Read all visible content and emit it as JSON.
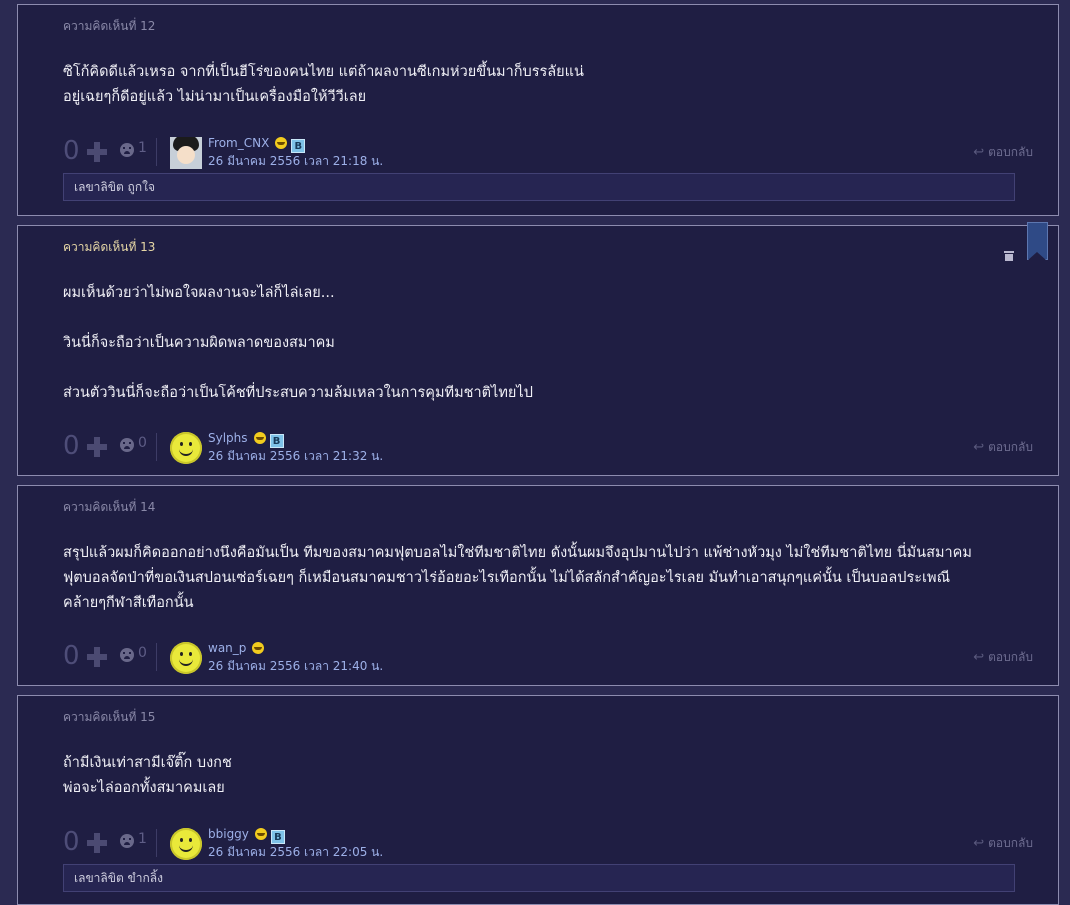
{
  "comments": [
    {
      "number": "ความคิดเห็นที่ 12",
      "body": "ซิโก้คิดดีแล้วเหรอ จากที่เป็นฮีโร่ของคนไทย แต่ถ้าผลงานซีเกมห่วยขึ้นมาก็บรรลัยแน่\nอยู่เฉยๆก็ดีอยู่แล้ว ไม่น่ามาเป็นเครื่องมือให้วีวีเลย",
      "votes": "0",
      "emotions": "1",
      "username": "From_CNX",
      "badge": "B",
      "date": "26 มีนาคม 2556 เวลา 21:18 น.",
      "reply": "ตอบกลับ",
      "note": "เลขาลิขิต ถูกใจ"
    },
    {
      "number": "ความคิดเห็นที่ 13",
      "body": "ผมเห็นด้วยว่าไม่พอใจผลงานจะไล่ก็ไล่เลย...\n\nวินนี่ก็จะถือว่าเป็นความผิดพลาดของสมาคม\n\nส่วนตัววินนี่ก็จะถือว่าเป็นโค้ชที่ประสบความล้มเหลวในการคุมทีมชาติไทยไป",
      "votes": "0",
      "emotions": "0",
      "username": "Sylphs",
      "badge": "B",
      "date": "26 มีนาคม 2556 เวลา 21:32 น.",
      "reply": "ตอบกลับ"
    },
    {
      "number": "ความคิดเห็นที่ 14",
      "body": "สรุปแล้วผมก็คิดออกอย่างนึงคือมันเป็น ทีมของสมาคมฟุตบอลไม่ใช่ทีมชาติไทย ดังนั้นผมจึงอุปมานไปว่า แพ้ช่างหัวมุง ไม่ใช่ทีมชาติไทย นี่มันสมาคม\nฟุตบอลจัดป่าที่ขอเงินสปอนเซ่อร์เฉยๆ ก็เหมือนสมาคมชาวไร่อ้อยอะไรเทือกนั้น ไม่ได้สลักสำคัญอะไรเลย มันทำเอาสนุกๆแค่นั้น เป็นบอลประเพณี\nคล้ายๆกีฬาสีเทือกนั้น",
      "votes": "0",
      "emotions": "0",
      "username": "wan_p",
      "date": "26 มีนาคม 2556 เวลา 21:40 น.",
      "reply": "ตอบกลับ"
    },
    {
      "number": "ความคิดเห็นที่ 15",
      "body": "ถ้ามีเงินเท่าสามีเจ๊ติ๊ก บงกช\nพ่อจะไล่ออกทั้งสมาคมเลย",
      "votes": "0",
      "emotions": "1",
      "username": "bbiggy",
      "badge": "B",
      "date": "26 มีนาคม 2556 เวลา 22:05 น.",
      "reply": "ตอบกลับ",
      "note": "เลขาลิขิต ขำกลิ้ง"
    }
  ]
}
